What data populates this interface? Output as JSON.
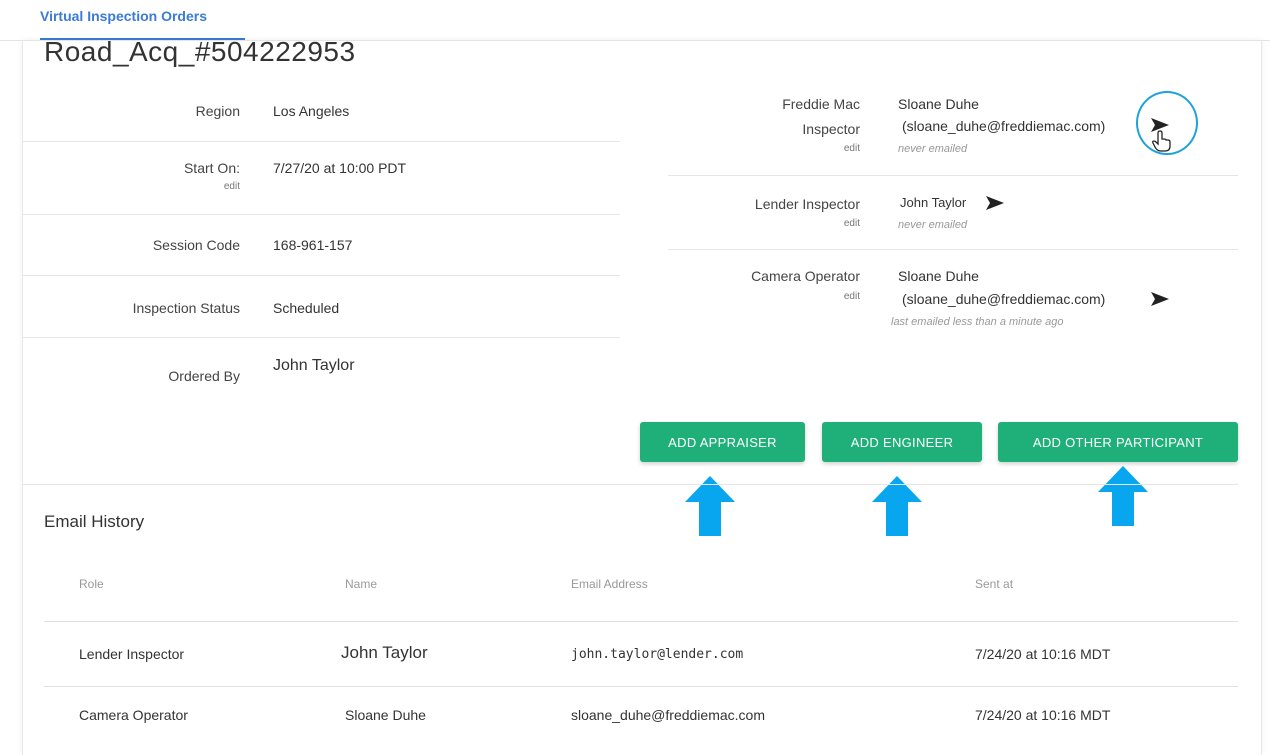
{
  "topbar": {
    "tab_label": "Virtual Inspection Orders"
  },
  "order": {
    "title": "Road_Acq_#504222953"
  },
  "details": [
    {
      "label": "Region",
      "value": "Los Angeles"
    },
    {
      "label": "Start On:",
      "sub": "edit",
      "value": "7/27/20 at 10:00 PDT"
    },
    {
      "label": "Session Code",
      "value": "168-961-157"
    },
    {
      "label": "Inspection Status",
      "value": "Scheduled"
    },
    {
      "label": "Ordered By",
      "value": "John Taylor"
    }
  ],
  "participants": [
    {
      "label_line1": "Freddie Mac",
      "label_line2": "Inspector",
      "edit": "edit",
      "name": "Sloane Duhe",
      "email": "(sloane_duhe@freddiemac.com)",
      "status": "never emailed"
    },
    {
      "label_line1": "Lender Inspector",
      "edit": "edit",
      "name": "John Taylor",
      "status": "never emailed"
    },
    {
      "label_line1": "Camera Operator",
      "edit": "edit",
      "name": "Sloane Duhe",
      "email": "(sloane_duhe@freddiemac.com)",
      "status": "last emailed less than a minute ago"
    }
  ],
  "buttons": {
    "add_appraiser": "ADD APPRAISER",
    "add_engineer": "ADD ENGINEER",
    "add_other": "ADD OTHER PARTICIPANT"
  },
  "email_history": {
    "title": "Email History",
    "columns": [
      "Role",
      "Name",
      "Email Address",
      "Sent at"
    ],
    "rows": [
      {
        "role": "Lender Inspector",
        "name": "John Taylor",
        "email": "john.taylor@lender.com",
        "sent": "7/24/20 at 10:16 MDT"
      },
      {
        "role": "Camera Operator",
        "name": "Sloane Duhe",
        "email": "sloane_duhe@freddiemac.com",
        "sent": "7/24/20 at 10:16 MDT"
      }
    ]
  },
  "colors": {
    "accent": "#3b7bd4",
    "button": "#1fb07a",
    "annotation": "#1fa2dc"
  },
  "icons": [
    "send-icon",
    "hand-cursor-icon",
    "up-arrow-icon"
  ]
}
